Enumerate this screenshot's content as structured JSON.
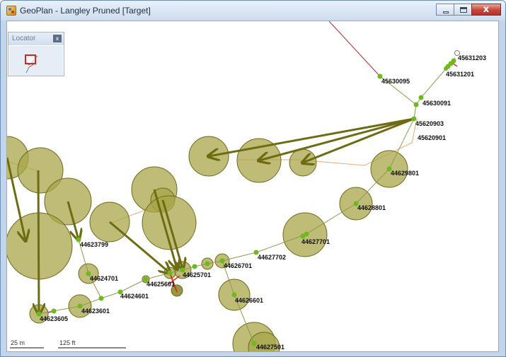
{
  "window": {
    "title": "GeoPlan - Langley Pruned [Target]",
    "close_glyph": "x"
  },
  "locator": {
    "title": "Locator",
    "close_glyph": "x"
  },
  "map": {
    "colors": {
      "circle_fill": "#a8a64a",
      "circle_stroke": "#6d6a1c",
      "pipe": "#8e9a4b",
      "node": "#6fb81e",
      "arrow": "#6e6c12",
      "orange_line": "#f0a878",
      "dark_red_line": "#a53030",
      "red_link": "#d8321e"
    },
    "nodes": [
      {
        "id": "45631203"
      },
      {
        "id": "45631201"
      },
      {
        "id": "45630095"
      },
      {
        "id": "45630091"
      },
      {
        "id": "45620903"
      },
      {
        "id": "45620901"
      },
      {
        "id": "44629801"
      },
      {
        "id": "44628801"
      },
      {
        "id": "44627701"
      },
      {
        "id": "44627702"
      },
      {
        "id": "44626701"
      },
      {
        "id": "44625701"
      },
      {
        "id": "44625601"
      },
      {
        "id": "44626601"
      },
      {
        "id": "44627501"
      },
      {
        "id": "44624601"
      },
      {
        "id": "44624701"
      },
      {
        "id": "44623799"
      },
      {
        "id": "44623601"
      },
      {
        "id": "44623605"
      }
    ],
    "scale_bars": [
      {
        "label": "25 m"
      },
      {
        "label": "125 ft"
      }
    ]
  }
}
